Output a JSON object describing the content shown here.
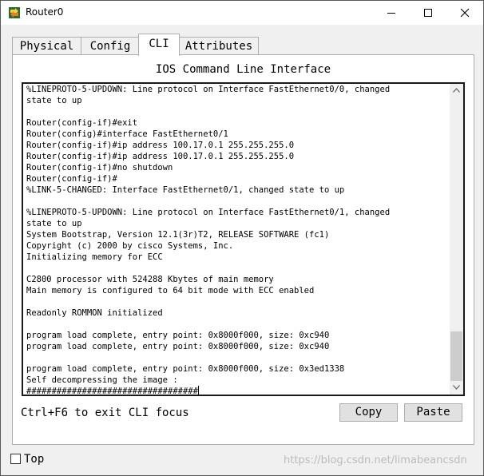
{
  "window": {
    "title": "Router0",
    "icon": "router-app-icon",
    "controls": {
      "minimize": "minimize-icon",
      "maximize": "maximize-icon",
      "close": "close-icon"
    }
  },
  "tabs": [
    {
      "label": "Physical",
      "active": false
    },
    {
      "label": "Config",
      "active": false
    },
    {
      "label": "CLI",
      "active": true
    },
    {
      "label": "Attributes",
      "active": false
    }
  ],
  "cli": {
    "title": "IOS Command Line Interface",
    "lines": [
      "%LINEPROTO-5-UPDOWN: Line protocol on Interface FastEthernet0/0, changed",
      "state to up",
      "",
      "Router(config-if)#exit",
      "Router(config)#interface FastEthernet0/1",
      "Router(config-if)#ip address 100.17.0.1 255.255.255.0",
      "Router(config-if)#ip address 100.17.0.1 255.255.255.0",
      "Router(config-if)#no shutdown",
      "Router(config-if)#",
      "%LINK-5-CHANGED: Interface FastEthernet0/1, changed state to up",
      "",
      "%LINEPROTO-5-UPDOWN: Line protocol on Interface FastEthernet0/1, changed",
      "state to up",
      "System Bootstrap, Version 12.1(3r)T2, RELEASE SOFTWARE (fc1)",
      "Copyright (c) 2000 by cisco Systems, Inc.",
      "Initializing memory for ECC",
      "",
      "C2800 processor with 524288 Kbytes of main memory",
      "Main memory is configured to 64 bit mode with ECC enabled",
      "",
      "Readonly ROMMON initialized",
      "",
      "program load complete, entry point: 0x8000f000, size: 0xc940",
      "program load complete, entry point: 0x8000f000, size: 0xc940",
      "",
      "program load complete, entry point: 0x8000f000, size: 0x3ed1338",
      "Self decompressing the image :",
      "##################################"
    ],
    "hint": "Ctrl+F6 to exit CLI focus",
    "copy_label": "Copy",
    "paste_label": "Paste"
  },
  "footer": {
    "top_label": "Top",
    "top_checked": false,
    "watermark": "https://blog.csdn.net/limabeancsdn"
  }
}
